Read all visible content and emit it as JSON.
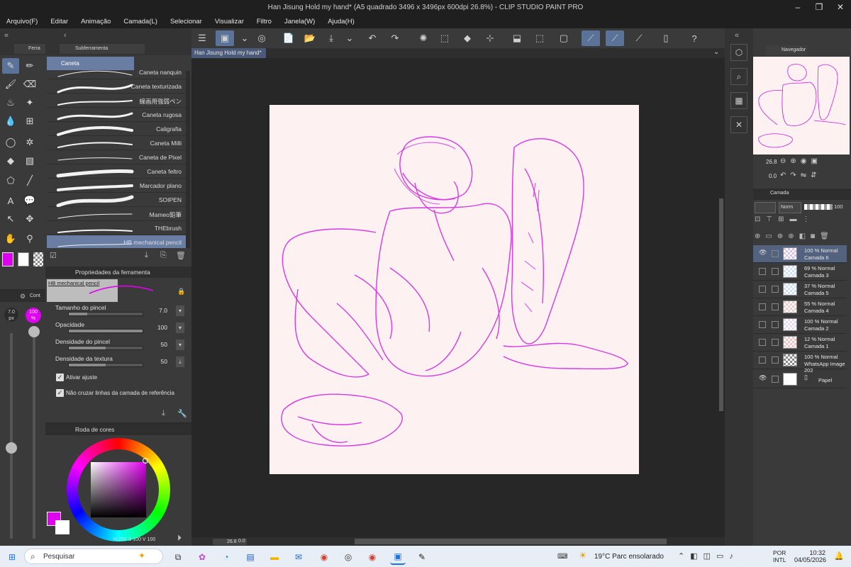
{
  "window": {
    "title": "Han Jisung Hold my hand* (A5 quadrado 3496 x 3496px 600dpi 26.8%) - CLIP STUDIO PAINT PRO"
  },
  "menu": [
    "Arquivo(F)",
    "Editar",
    "Animação",
    "Camada(L)",
    "Selecionar",
    "Visualizar",
    "Filtro",
    "Janela(W)",
    "Ajuda(H)"
  ],
  "left": {
    "tool_tab": "Ferra",
    "subtool_tab": "Subferramenta",
    "subtool_group": "Caneta",
    "brushes": [
      "Caneta nanquin",
      "Caneta texturizada",
      "線画用強弱ペン",
      "Caneta rugosa",
      "Caligrafia",
      "Caneta Milli",
      "Caneta de Pixel",
      "Caneta feltro",
      "Marcador plano",
      "SOIPEN",
      "Mameo鉛筆",
      "THEbrush",
      "HB mechanical pencil"
    ],
    "props_tab": "Propriedades da ferramenta",
    "props_brush": "HB mechanical pencil",
    "props": [
      {
        "label": "Tamanho do pincel",
        "value": "7.0",
        "fill": 0.25
      },
      {
        "label": "Opacidade",
        "value": "100",
        "fill": 1.0
      },
      {
        "label": "Densidade do pincel",
        "value": "50",
        "fill": 0.5
      },
      {
        "label": "Densidade da textura",
        "value": "50",
        "fill": 0.5
      }
    ],
    "check1": "Ativar ajuste",
    "check2": "Não cruzar linhas da camada de referência",
    "size_badge": "7.0",
    "size_unit": "px",
    "opacity_badge": "100",
    "opacity_unit": "%",
    "color_tab": "Roda de cores",
    "color_tab_short": "Cont",
    "hsv": {
      "h_label": "H",
      "h": "292",
      "s_label": "S",
      "s": "100",
      "v_label": "V",
      "v": "100"
    },
    "accent": "#e000f0"
  },
  "canvas": {
    "tab_title": "Han Jisung Hold my hand*",
    "zoom": "26.8",
    "angle": "0.0"
  },
  "right": {
    "navigator_tab": "Navegador",
    "nav_zoom": "26.8",
    "nav_angle": "0.0",
    "layer_tab": "Camada",
    "blend": "Norm",
    "opacity": "100",
    "layers": [
      {
        "l1": "100 % Normal",
        "l2": "Camada 6",
        "visible": true,
        "selected": true
      },
      {
        "l1": "69 % Normal",
        "l2": "Camada 3",
        "visible": false
      },
      {
        "l1": "37 % Normal",
        "l2": "Camada 5",
        "visible": false
      },
      {
        "l1": "55 % Normal",
        "l2": "Camada 4",
        "visible": false
      },
      {
        "l1": "100 % Normal",
        "l2": "Camada 2",
        "visible": false
      },
      {
        "l1": "12 % Normal",
        "l2": "Camada 1",
        "visible": false
      },
      {
        "l1": "100 % Normal",
        "l2": "WhatsApp Image 202",
        "visible": false
      }
    ],
    "paper_layer": "Papel"
  },
  "taskbar": {
    "search": "Pesquisar",
    "weather": "19°C  Parc ensolarado",
    "lang1": "POR",
    "lang2": "INTL",
    "time": "10:32",
    "date": "04/05/2026"
  }
}
